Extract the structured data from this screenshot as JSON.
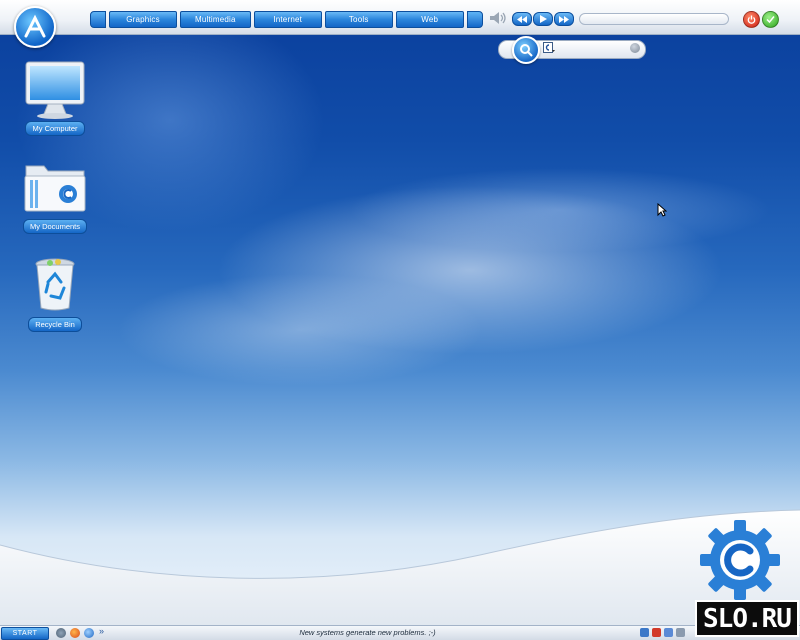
{
  "menu": {
    "items": [
      "Graphics",
      "Multimedia",
      "Internet",
      "Tools",
      "Web"
    ]
  },
  "media": {
    "icons": [
      "volume-icon",
      "rewind-icon",
      "play-icon",
      "fast-forward-icon"
    ],
    "progress_fraction": 0.0
  },
  "system_buttons": [
    "power-icon",
    "ok-icon"
  ],
  "search": {
    "placeholder": "",
    "engine_icon": "search-engine-icon"
  },
  "desktop": {
    "icons": [
      {
        "label": "My Computer",
        "icon": "monitor-icon"
      },
      {
        "label": "My Documents",
        "icon": "folder-icon"
      },
      {
        "label": "Recycle Bin",
        "icon": "recycle-bin-icon"
      }
    ]
  },
  "taskbar": {
    "start_label": "START",
    "quick_launch": [
      "tools-icon",
      "firefox-icon",
      "media-player-icon",
      "more-chevron-icon"
    ],
    "ticker": "New systems generate new problems. ;-)",
    "tray": [
      "tray-icon-1",
      "tray-icon-2",
      "tray-icon-3",
      "tray-icon-4"
    ]
  },
  "watermark": {
    "text": "SLO.RU"
  },
  "colors": {
    "accent_blue": "#1366c6",
    "sky_top": "#0a3e9c",
    "power_red": "#cc1c10",
    "ok_green": "#2aa41a"
  }
}
